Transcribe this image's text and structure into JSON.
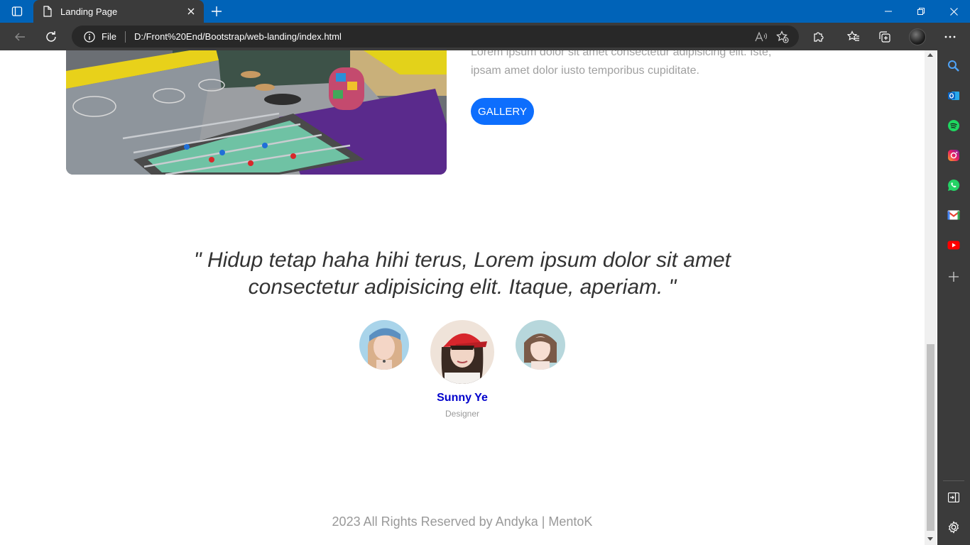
{
  "browser": {
    "tab_title": "Landing Page",
    "address_label": "File",
    "url": "D:/Front%20End/Bootstrap/web-landing/index.html"
  },
  "page": {
    "lorem_text": "Lorem ipsum dolor sit amet consectetur adipisicing elit. Iste, ipsam amet dolor iusto temporibus cupiditate.",
    "gallery_button": "GALLERY",
    "quote": "\" Hidup tetap haha hihi terus, Lorem ipsum dolor sit amet consectetur adipisicing elit. Itaque, aperiam. \"",
    "testimonial": {
      "name": "Sunny Ye",
      "role": "Designer"
    },
    "footer": "2023 All Rights Reserved by Andyka | MentoK"
  },
  "colors": {
    "titlebar": "#0063b8",
    "chrome": "#3b3b3b",
    "accent_button": "#0d6efd",
    "testimonial_name": "#0000cc"
  },
  "sidebar_icons": [
    "search-icon",
    "outlook-icon",
    "spotify-icon",
    "instagram-icon",
    "whatsapp-icon",
    "gmail-icon",
    "youtube-icon",
    "add-icon",
    "split-screen-icon",
    "settings-icon"
  ]
}
